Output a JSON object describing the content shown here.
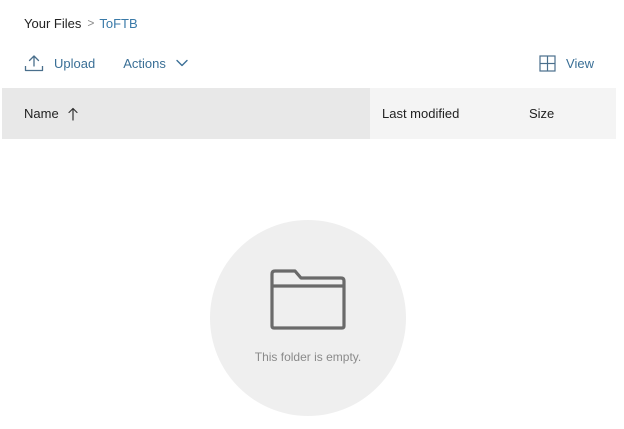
{
  "breadcrumb": {
    "root": "Your Files",
    "separator": ">",
    "current": "ToFTB"
  },
  "toolbar": {
    "upload_label": "Upload",
    "upload_icon": "upload-icon",
    "actions_label": "Actions",
    "actions_icon": "chevron-down-icon",
    "view_label": "View",
    "view_icon": "grid-view-icon"
  },
  "table": {
    "columns": [
      {
        "label": "Name",
        "sort": "ascending",
        "sort_icon": "arrow-up-icon"
      },
      {
        "label": "Last modified"
      },
      {
        "label": "Size"
      }
    ],
    "rows": []
  },
  "empty_state": {
    "icon": "folder-icon",
    "message": "This folder is empty."
  },
  "colors": {
    "accent": "#3a6f96",
    "breadcrumb_link": "#3a7aa8",
    "header_bg": "#f4f4f4",
    "sorted_column_bg": "#e8e8e8",
    "empty_circle": "#efefef"
  }
}
